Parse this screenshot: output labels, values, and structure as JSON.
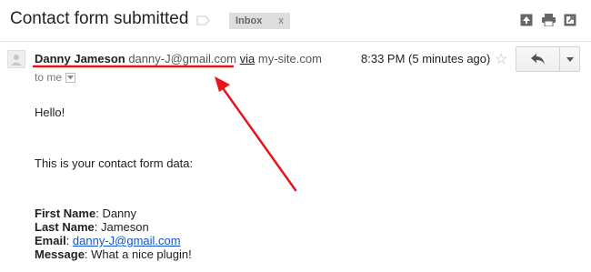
{
  "email": {
    "subject": "Contact form submitted",
    "inbox_label": "Inbox",
    "inbox_remove": "x",
    "sender_name": "Danny Jameson",
    "sender_email": "danny-J@gmail.com",
    "via": "via",
    "via_site": "my-site.com",
    "to": "to me",
    "time": "8:33 PM (5 minutes ago)"
  },
  "body": {
    "greeting": "Hello!",
    "intro": "This is your contact form data:",
    "fields": [
      {
        "label": "First Name",
        "value": "Danny"
      },
      {
        "label": "Last Name",
        "value": "Jameson"
      },
      {
        "label": "Email",
        "value": "danny-J@gmail.com"
      },
      {
        "label": "Message",
        "value": "What a nice plugin!"
      }
    ]
  },
  "icons": {
    "label": "label-icon",
    "print_all": "expand-all-icon",
    "print": "print-icon",
    "new_window": "new-window-icon",
    "avatar": "avatar-icon",
    "star": "star-icon",
    "reply": "reply-icon",
    "more": "chevron-down-icon"
  },
  "colors": {
    "annotation": "#e8141c",
    "link": "#1155cc"
  }
}
